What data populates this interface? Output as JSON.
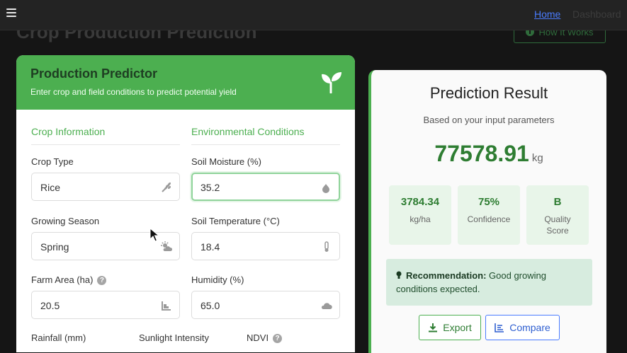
{
  "nav": {
    "home": "Home",
    "dashboard": "Dashboard"
  },
  "page": {
    "title": "Crop Production Prediction",
    "how_it_works": "How It Works"
  },
  "predictor": {
    "title": "Production Predictor",
    "subtitle": "Enter crop and field conditions to predict potential yield",
    "sections": {
      "crop": "Crop Information",
      "env": "Environmental Conditions"
    },
    "fields": {
      "crop_type": {
        "label": "Crop Type",
        "value": "Rice"
      },
      "growing_season": {
        "label": "Growing Season",
        "value": "Spring"
      },
      "farm_area": {
        "label": "Farm Area (ha)",
        "value": "20.5"
      },
      "soil_moisture": {
        "label": "Soil Moisture (%)",
        "value": "35.2"
      },
      "soil_temperature": {
        "label": "Soil Temperature (°C)",
        "value": "18.4"
      },
      "humidity": {
        "label": "Humidity (%)",
        "value": "65.0"
      },
      "rainfall": {
        "label": "Rainfall (mm)"
      },
      "sunlight": {
        "label": "Sunlight Intensity"
      },
      "ndvi": {
        "label": "NDVI"
      }
    }
  },
  "result": {
    "title": "Prediction Result",
    "subtitle": "Based on your input parameters",
    "value": "77578.91",
    "unit": "kg",
    "stats": [
      {
        "value": "3784.34",
        "label": "kg/ha"
      },
      {
        "value": "75%",
        "label": "Confidence"
      },
      {
        "value": "B",
        "label": "Quality Score"
      }
    ],
    "recommendation_label": "Recommendation:",
    "recommendation_text": "Good growing conditions expected.",
    "export": "Export",
    "compare": "Compare"
  },
  "colors": {
    "accent": "#4caf50",
    "accent_dark": "#2e7d32",
    "link": "#4a7cff"
  }
}
